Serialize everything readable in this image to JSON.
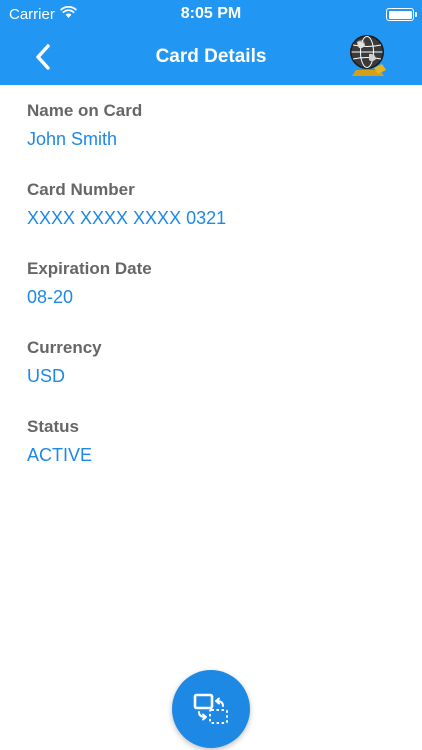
{
  "status_bar": {
    "carrier": "Carrier",
    "time": "8:05 PM"
  },
  "nav": {
    "title": "Card Details",
    "back_icon": "chevron-left-icon",
    "globe_icon": "globe-icon"
  },
  "fields": [
    {
      "label": "Name on Card",
      "value": "John Smith"
    },
    {
      "label": "Card Number",
      "value": "XXXX XXXX XXXX 0321"
    },
    {
      "label": "Expiration Date",
      "value": "08-20"
    },
    {
      "label": "Currency",
      "value": "USD"
    },
    {
      "label": "Status",
      "value": "ACTIVE"
    }
  ],
  "fab": {
    "icon": "switch-card-icon"
  },
  "colors": {
    "header": "#2196f3",
    "value_text": "#1e88e5",
    "label_text": "#666666",
    "fab": "#1e88e5"
  }
}
